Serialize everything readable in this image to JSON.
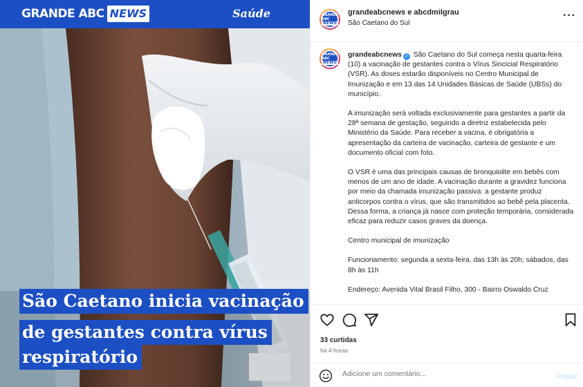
{
  "media": {
    "brand_name": "GRANDE ABC",
    "brand_news": "NEWS",
    "section": "Saúde",
    "headline_lines": [
      "São Caetano inicia vacinação",
      "de gestantes contra vírus",
      "respiratório"
    ]
  },
  "header": {
    "accounts": "grandeabcnews e abcdmilgrau",
    "location": "São Caetano do Sul",
    "more": "···",
    "avatar_line1": "GRANDE ABC",
    "avatar_news": "NEWS"
  },
  "caption": {
    "username": "grandeabcnews",
    "paragraphs": [
      "São Caetano do Sul começa nesta quarta-feira (10) a vacinação de gestantes contra o Vírus Sincicial Respiratório (VSR). As doses estarão disponíveis no Centro Municipal de Imunização e em 13 das 14 Unidades Básicas de Saúde (UBSs) do município.",
      "A imunização será voltada exclusivamente para gestantes a partir da 28ª semana de gestação, seguindo a diretriz estabelecida pelo Ministério da Saúde. Para receber a vacina, é obrigatória a apresentação da carteira de vacinação, carteira de gestante e um documento oficial com foto.",
      "O VSR é uma das principais causas de bronquiolite em bebês com menos de um ano de idade. A vacinação durante a gravidez funciona por meio da chamada imunização passiva: a gestante produz anticorpos contra o vírus, que são transmitidos ao bebê pela placenta. Dessa forma, a criança já nasce com proteção temporária, considerada eficaz para reduzir casos graves da doença.",
      "Centro municipal de imunização",
      "Funcionamento: segunda a sexta-feira, das 13h às 20h; sábados, das 8h às 11h",
      "Endereço: Avenida Vital Brasil Filho, 300 - Bairro Oswaldo Cruz"
    ]
  },
  "stats": {
    "likes": "33 curtidas",
    "time": "há 4 horas"
  },
  "comment": {
    "placeholder": "Adicione um comentário...",
    "post_label": "Postar"
  },
  "colors": {
    "brand_blue": "#1d4fc4",
    "post_button": "#b2dffc",
    "verified": "#3897f0"
  }
}
